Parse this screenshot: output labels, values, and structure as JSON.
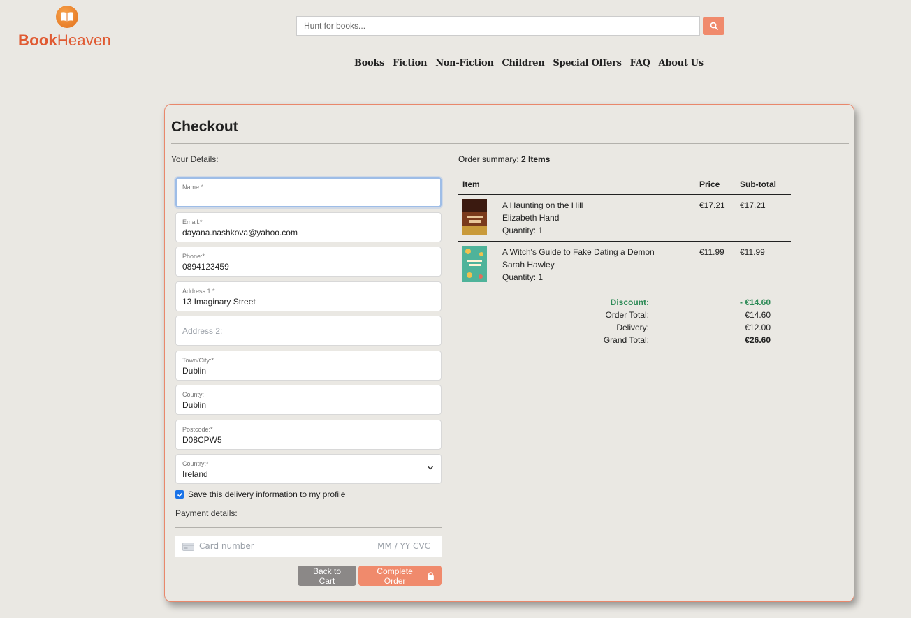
{
  "brand": {
    "name_bold": "Book",
    "name_light": "Heaven",
    "logo_icon": "open-book-icon"
  },
  "search": {
    "placeholder": "Hunt for books...",
    "button_icon": "search-icon"
  },
  "nav": [
    "Books",
    "Fiction",
    "Non-Fiction",
    "Children",
    "Special Offers",
    "FAQ",
    "About Us"
  ],
  "checkout": {
    "title": "Checkout",
    "details_label": "Your Details:",
    "fields": {
      "name": {
        "label": "Name:*",
        "value": ""
      },
      "email": {
        "label": "Email:*",
        "value": "dayana.nashkova@yahoo.com"
      },
      "phone": {
        "label": "Phone:*",
        "value": "0894123459"
      },
      "address1": {
        "label": "Address 1:*",
        "value": "13 Imaginary Street"
      },
      "address2": {
        "placeholder": "Address 2:"
      },
      "town": {
        "label": "Town/City:*",
        "value": "Dublin"
      },
      "county": {
        "label": "County:",
        "value": "Dublin"
      },
      "postcode": {
        "label": "Postcode:*",
        "value": "D08CPW5"
      },
      "country": {
        "label": "Country:*",
        "value": "Ireland"
      }
    },
    "save_info": {
      "label": "Save this delivery information to my profile",
      "checked": true
    },
    "payment_label": "Payment details:",
    "card": {
      "number_placeholder": "Card number",
      "expiry_cvc_placeholder": "MM / YY  CVC"
    },
    "buttons": {
      "back": "Back to Cart",
      "complete": "Complete Order",
      "complete_icon": "lock-icon"
    }
  },
  "summary": {
    "label": "Order summary:",
    "count": "2 Items",
    "headers": {
      "item": "Item",
      "price": "Price",
      "subtotal": "Sub-total"
    },
    "items": [
      {
        "title": "A Haunting on the Hill",
        "author": "Elizabeth Hand",
        "quantity": "Quantity: 1",
        "price": "€17.21",
        "subtotal": "€17.21",
        "cover_color": "#7a3a1c"
      },
      {
        "title": "A Witch's Guide to Fake Dating a Demon",
        "author": "Sarah Hawley",
        "quantity": "Quantity: 1",
        "price": "€11.99",
        "subtotal": "€11.99",
        "cover_color": "#4fb39a"
      }
    ],
    "totals": {
      "discount_label": "Discount:",
      "discount_value": "- €14.60",
      "order_total_label": "Order Total:",
      "order_total_value": "€14.60",
      "delivery_label": "Delivery:",
      "delivery_value": "€12.00",
      "grand_total_label": "Grand Total:",
      "grand_total_value": "€26.60"
    }
  },
  "colors": {
    "accent": "#f08a6c",
    "brand": "#e05a32",
    "background": "#eae8e3",
    "discount": "#2e8b57",
    "secondary_button": "#8b8887"
  }
}
